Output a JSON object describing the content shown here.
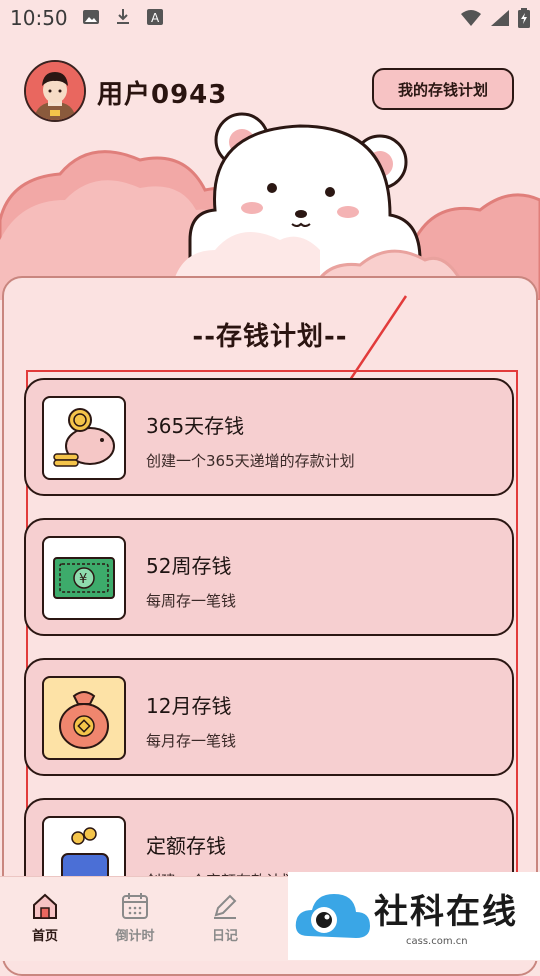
{
  "status": {
    "time": "10:50"
  },
  "header": {
    "username": "用户0943",
    "my_plan_button": "我的存钱计划"
  },
  "section": {
    "title": "--存钱计划--"
  },
  "plans": [
    {
      "name": "365天存钱",
      "desc": "创建一个365天递增的存款计划",
      "icon": "piggy-bank-icon"
    },
    {
      "name": "52周存钱",
      "desc": "每周存一笔钱",
      "icon": "banknote-icon"
    },
    {
      "name": "12月存钱",
      "desc": "每月存一笔钱",
      "icon": "money-bag-icon"
    },
    {
      "name": "定额存钱",
      "desc": "创建一个定额存款计划",
      "icon": "coin-purse-icon"
    }
  ],
  "tabs": [
    {
      "label": "首页",
      "icon": "home-icon",
      "active": true
    },
    {
      "label": "倒计时",
      "icon": "calendar-icon",
      "active": false
    },
    {
      "label": "日记",
      "icon": "pencil-icon",
      "active": false
    }
  ],
  "watermark": {
    "name": "社科在线",
    "domain": "cass.com.cn"
  },
  "colors": {
    "accent": "#e23b3b",
    "card": "#f6cfd0",
    "background": "#fbe3e2"
  }
}
